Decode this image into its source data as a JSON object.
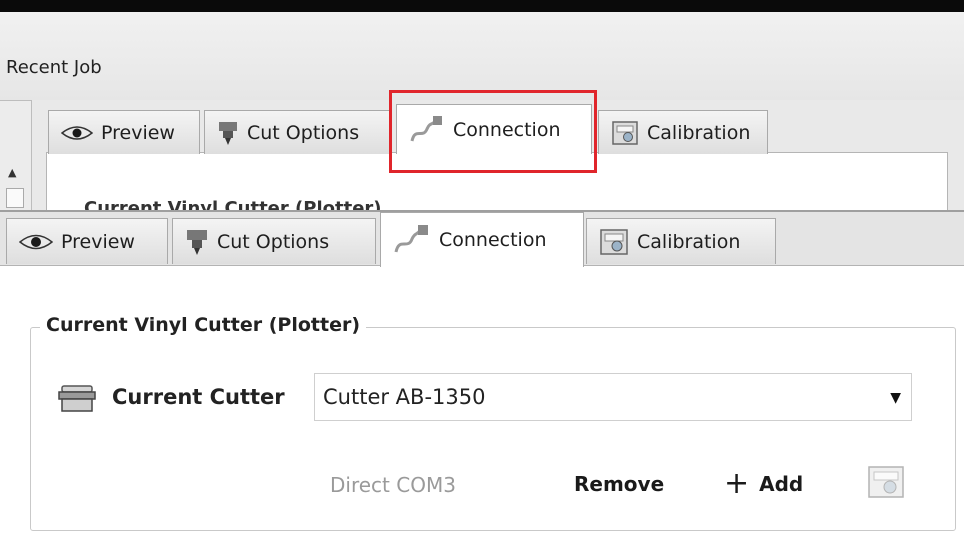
{
  "menu": {
    "recent_job": "Recent Job"
  },
  "back_tabs": [
    {
      "label": "Preview",
      "icon": "eye-icon"
    },
    {
      "label": "Cut Options",
      "icon": "cutter-head-icon"
    },
    {
      "label": "Connection",
      "icon": "cable-plug-icon",
      "active": true
    },
    {
      "label": "Calibration",
      "icon": "calibration-icon"
    }
  ],
  "back_content": {
    "partial_heading": "Current Vinyl Cutter (Plotter)"
  },
  "tabs": [
    {
      "label": "Preview",
      "icon": "eye-icon"
    },
    {
      "label": "Cut Options",
      "icon": "cutter-head-icon"
    },
    {
      "label": "Connection",
      "icon": "cable-plug-icon",
      "active": true
    },
    {
      "label": "Calibration",
      "icon": "calibration-icon"
    }
  ],
  "connection": {
    "group_title": "Current Vinyl Cutter (Plotter)",
    "current_cutter_label": "Current Cutter",
    "cutter_select_value": "Cutter AB-1350",
    "port": "Direct COM3",
    "remove_label": "Remove",
    "add_label": "Add"
  },
  "colors": {
    "highlight": "#e0252b",
    "tab_active": "#ffffff",
    "tab_inactive": "#e2e2e2"
  }
}
